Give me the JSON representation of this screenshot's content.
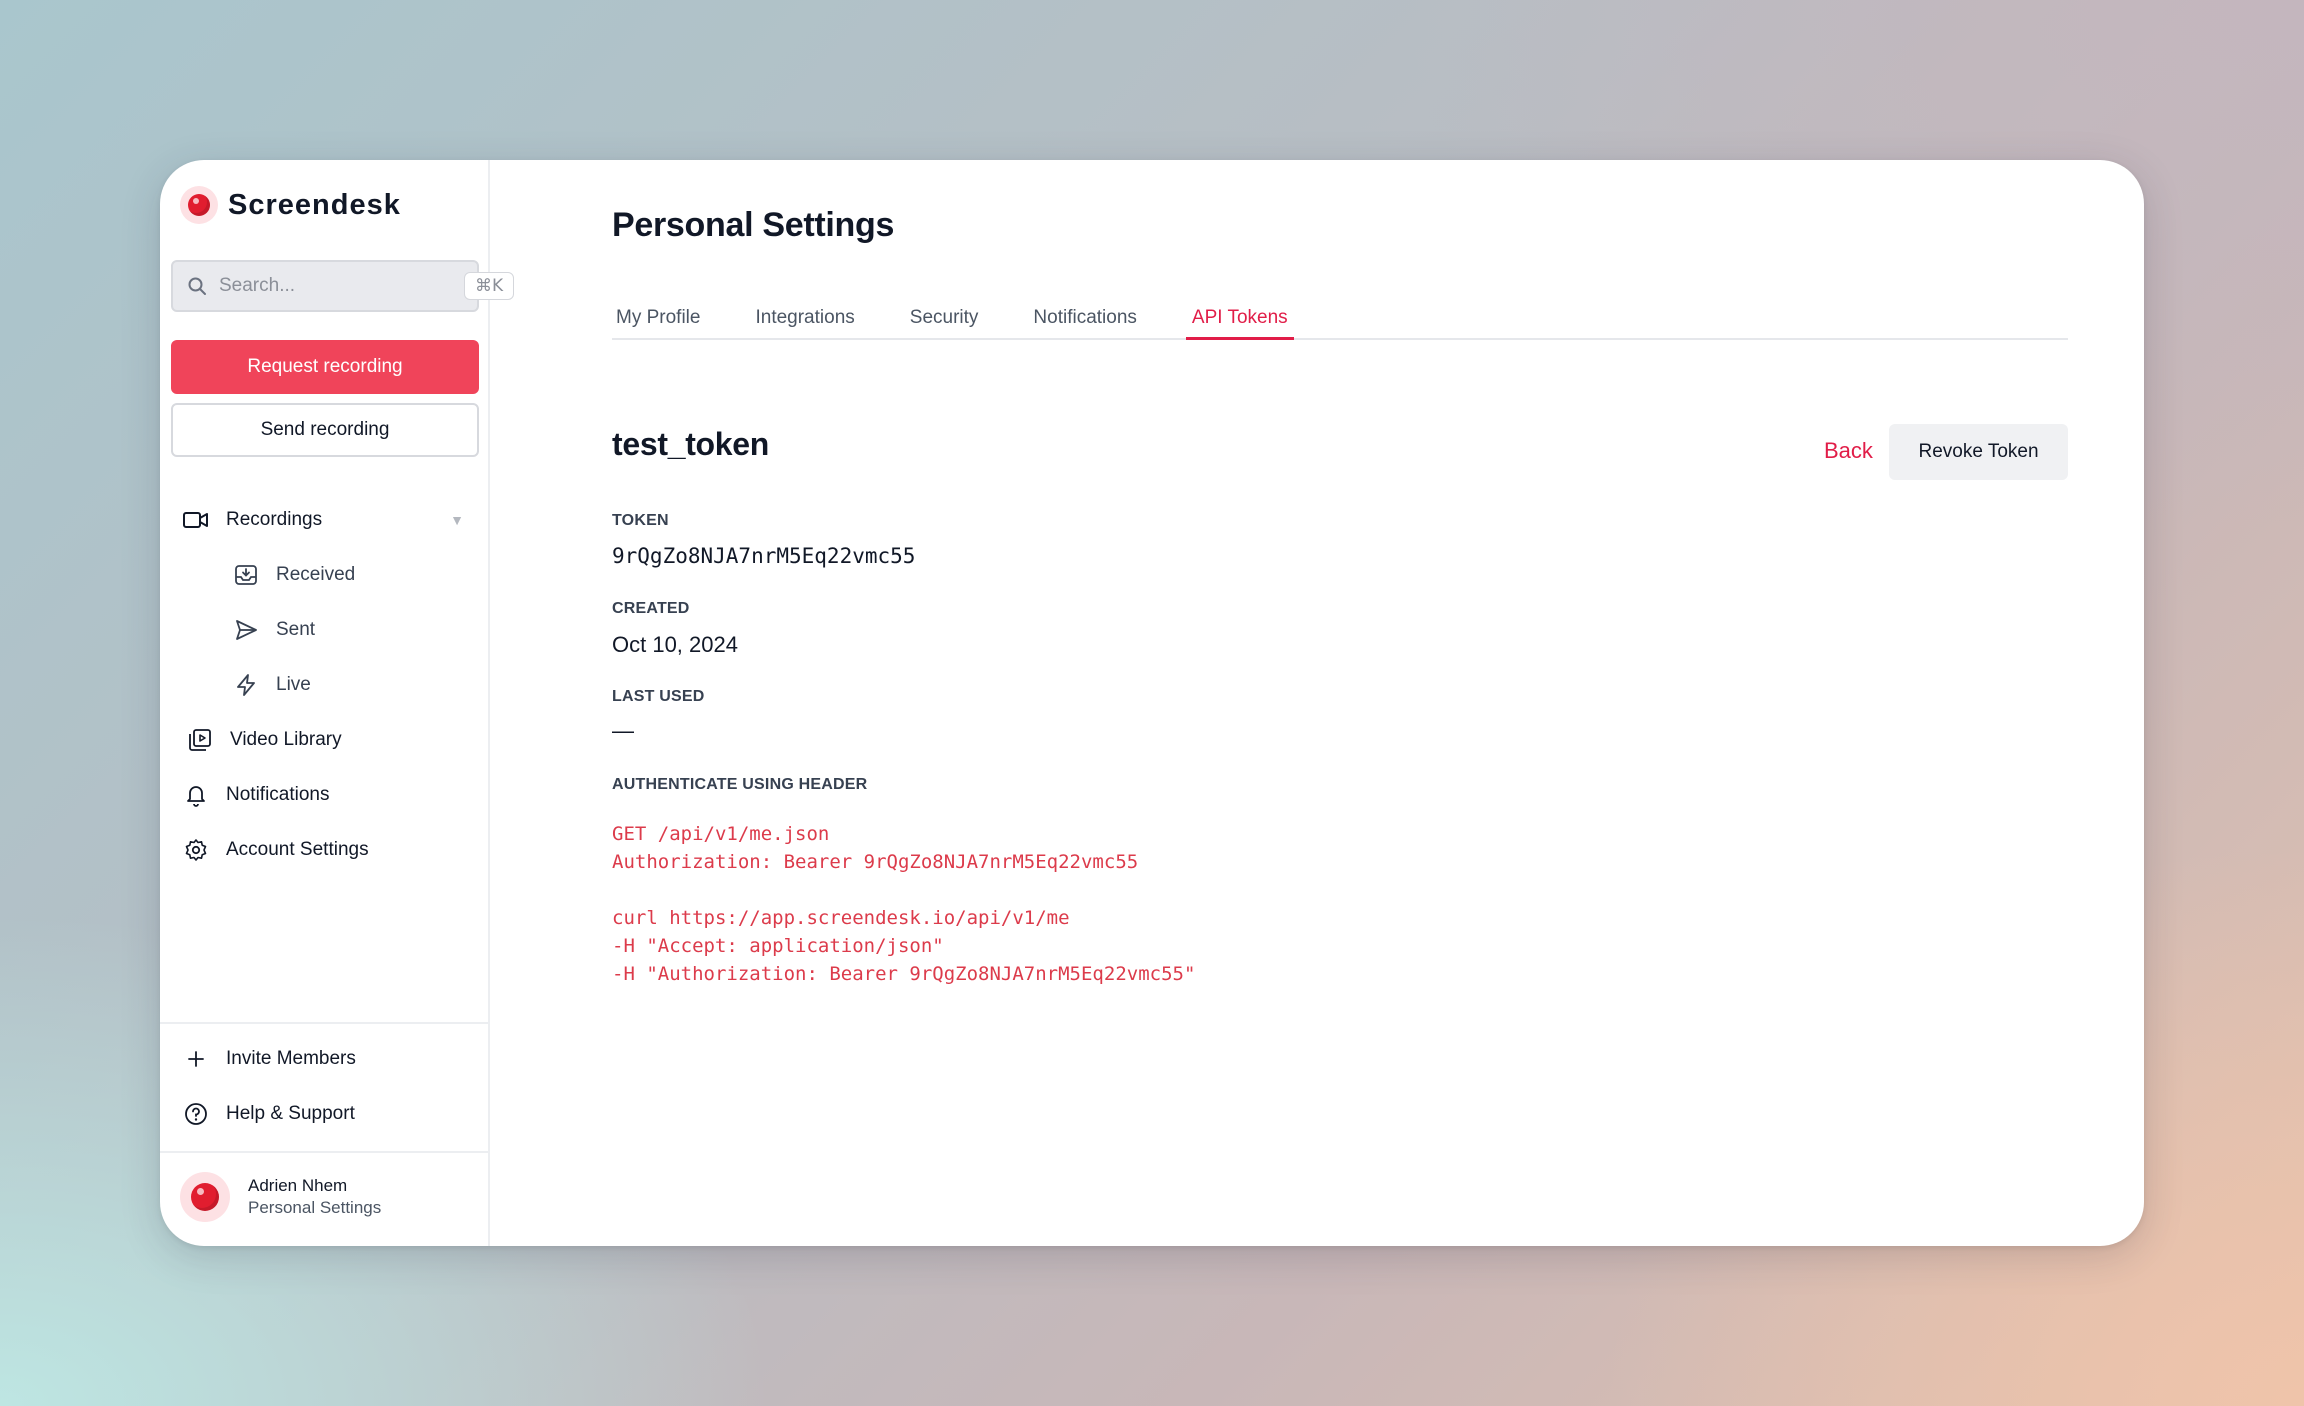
{
  "brand": {
    "name": "Screendesk"
  },
  "search": {
    "placeholder": "Search...",
    "shortcut": "⌘K"
  },
  "actions": {
    "request": "Request recording",
    "send": "Send recording"
  },
  "nav": {
    "recordings": "Recordings",
    "received": "Received",
    "sent": "Sent",
    "live": "Live",
    "video_library": "Video Library",
    "notifications": "Notifications",
    "account_settings": "Account Settings"
  },
  "bottom_nav": {
    "invite": "Invite Members",
    "help": "Help & Support"
  },
  "user": {
    "name": "Adrien Nhem",
    "subtitle": "Personal Settings"
  },
  "page": {
    "title": "Personal Settings"
  },
  "tabs": [
    {
      "label": "My Profile"
    },
    {
      "label": "Integrations"
    },
    {
      "label": "Security"
    },
    {
      "label": "Notifications"
    },
    {
      "label": "API Tokens",
      "active": true
    }
  ],
  "token": {
    "name": "test_token",
    "back_label": "Back",
    "revoke_label": "Revoke Token",
    "token_label": "TOKEN",
    "token_value": "9rQgZo8NJA7nrM5Eq22vmc55",
    "created_label": "CREATED",
    "created_value": "Oct 10, 2024",
    "last_used_label": "LAST USED",
    "last_used_value": "—",
    "auth_label": "AUTHENTICATE USING HEADER",
    "code_lines": [
      "GET /api/v1/me.json",
      "Authorization: Bearer 9rQgZo8NJA7nrM5Eq22vmc55",
      "",
      "curl https://app.screendesk.io/api/v1/me",
      "-H \"Accept: application/json\"",
      "-H \"Authorization: Bearer 9rQgZo8NJA7nrM5Eq22vmc55\""
    ]
  },
  "colors": {
    "accent": "#e11d48",
    "primary_button": "#f0445a",
    "code": "#dc3b4b"
  }
}
